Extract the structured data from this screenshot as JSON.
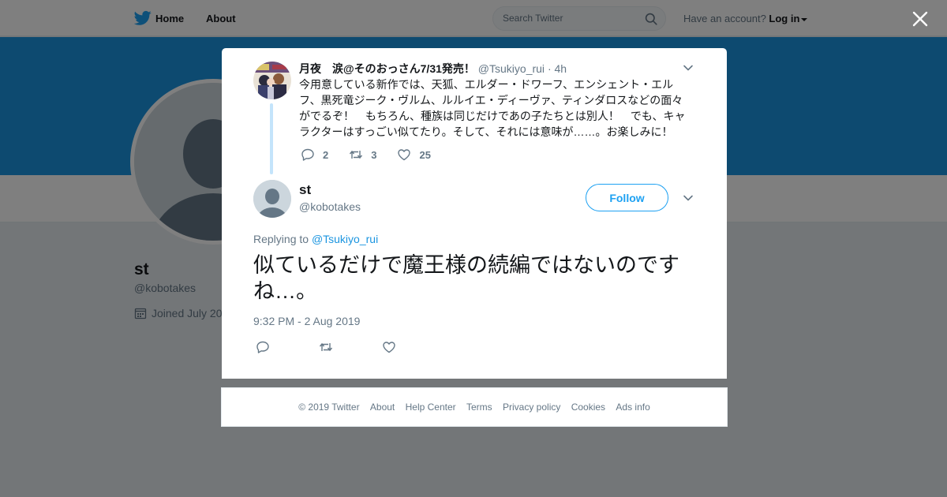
{
  "nav": {
    "home_label": "Home",
    "about_label": "About",
    "search_placeholder": "Search Twitter",
    "have_account": "Have an account?",
    "login_label": "Log in"
  },
  "profile": {
    "name": "st",
    "handle": "@kobotakes",
    "joined": "Joined July 20"
  },
  "parent_tweet": {
    "author_name": "月夜　涙@そのおっさん7/31発売！",
    "author_handle": "@Tsukiyo_rui",
    "time": "4h",
    "text": "今用意している新作では、天狐、エルダー・ドワーフ、エンシェント・エルフ、黒死竜ジーク・ヴルム、ルルイエ・ディーヴァ、ティンダロスなどの面々がでるぞ！　もちろん、種族は同じだけであの子たちとは別人！　でも、キャラクターはすっごい似てたり。そして、それには意味が……。お楽しみに！",
    "replies": "2",
    "retweets": "3",
    "likes": "25"
  },
  "tweet": {
    "author_name": "st",
    "author_handle": "@kobotakes",
    "follow_label": "Follow",
    "replying_prefix": "Replying to",
    "replying_handle": "@Tsukiyo_rui",
    "text": "似ているだけで魔王様の続編ではないのですね…。",
    "timestamp": "9:32 PM - 2 Aug 2019"
  },
  "footer": {
    "links": [
      "© 2019 Twitter",
      "About",
      "Help Center",
      "Terms",
      "Privacy policy",
      "Cookies",
      "Ads info"
    ]
  },
  "colors": {
    "brand": "#1da1f2",
    "banner": "#1b95e0",
    "link": "#1b95e0",
    "text_primary": "#14171a",
    "text_secondary": "#657786"
  },
  "icons": {
    "logo": "twitter-bird-icon",
    "search": "search-icon",
    "close": "close-icon",
    "reply": "reply-icon",
    "retweet": "retweet-icon",
    "like": "heart-icon",
    "caret": "chevron-down-icon",
    "calendar": "calendar-icon"
  }
}
